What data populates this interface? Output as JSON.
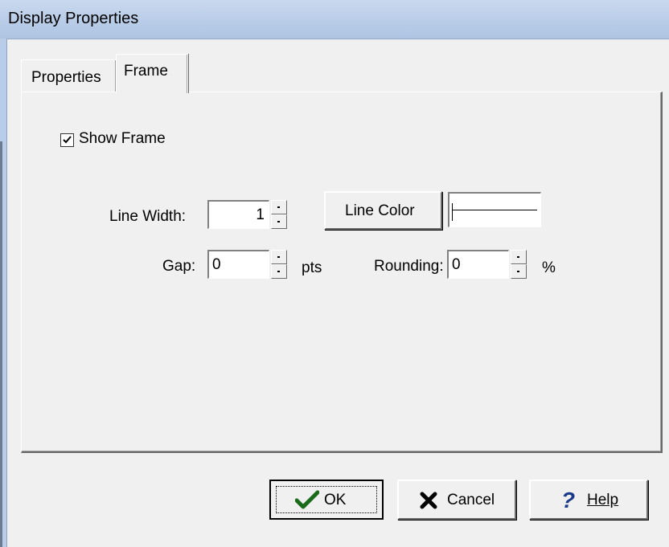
{
  "window": {
    "title": "Display Properties"
  },
  "tabs": [
    {
      "label": "Properties"
    },
    {
      "label": "Frame"
    }
  ],
  "frame": {
    "show_frame": {
      "label": "Show Frame",
      "checked": true
    },
    "line_width": {
      "label": "Line Width:",
      "value": "1"
    },
    "line_color_button": "Line Color",
    "gap": {
      "label": "Gap:",
      "value": "0",
      "unit": "pts"
    },
    "rounding": {
      "label": "Rounding:",
      "value": "0",
      "unit": "%"
    }
  },
  "buttons": {
    "ok": "OK",
    "cancel": "Cancel",
    "help": "Help"
  },
  "icons": {
    "ok": "checkmark-icon",
    "cancel": "x-icon",
    "help": "question-mark-icon"
  },
  "colors": {
    "title_bar": "#b9cde8",
    "ok_check": "#1a6b1a",
    "help_mark": "#1a3a8a"
  }
}
